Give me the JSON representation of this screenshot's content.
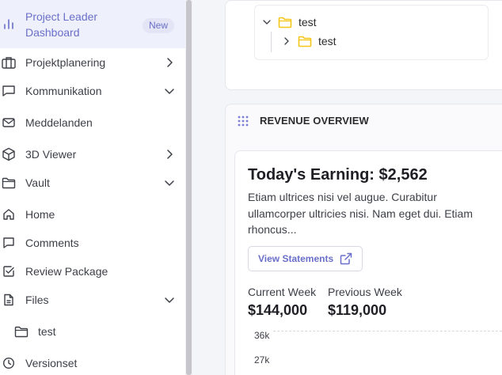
{
  "sidebar": {
    "items": [
      {
        "label": "Project Leader Dashboard",
        "badge": "New",
        "icon": "bar-chart-icon"
      },
      {
        "label": "Projektplanering",
        "icon": "briefcase-icon",
        "chevron": "right"
      },
      {
        "label": "Kommunikation",
        "icon": "chat-icon",
        "chevron": "down"
      },
      {
        "label": "Meddelanden",
        "icon": "mail-icon"
      },
      {
        "label": "3D Viewer",
        "icon": "cube-icon",
        "chevron": "right"
      },
      {
        "label": "Vault",
        "icon": "folder-icon",
        "chevron": "down"
      },
      {
        "label": "Home",
        "icon": "home-icon"
      },
      {
        "label": "Comments",
        "icon": "comment-icon"
      },
      {
        "label": "Review Package",
        "icon": "checkbox-icon"
      },
      {
        "label": "Files",
        "icon": "file-icon",
        "chevron": "down"
      },
      {
        "label": "test",
        "icon": "folder-icon"
      },
      {
        "label": "Versionset",
        "icon": "clock-icon"
      }
    ]
  },
  "tree": {
    "root": "test",
    "child": "test"
  },
  "revenue": {
    "header": "REVENUE OVERVIEW",
    "earning_title": "Today's Earning: $2,562",
    "description": "Etiam ultrices nisi vel augue. Curabitur ullamcorper ultricies nisi. Nam eget dui. Etiam rhoncus...",
    "button_label": "View Statements",
    "current_week_label": "Current Week",
    "current_week_value": "$144,000",
    "previous_week_label": "Previous Week",
    "previous_week_value": "$119,000",
    "ticks": [
      "36k",
      "27k"
    ]
  },
  "colors": {
    "accent": "#6a6fc9",
    "active_bg": "#eef0fb",
    "folder": "#f5c518"
  }
}
